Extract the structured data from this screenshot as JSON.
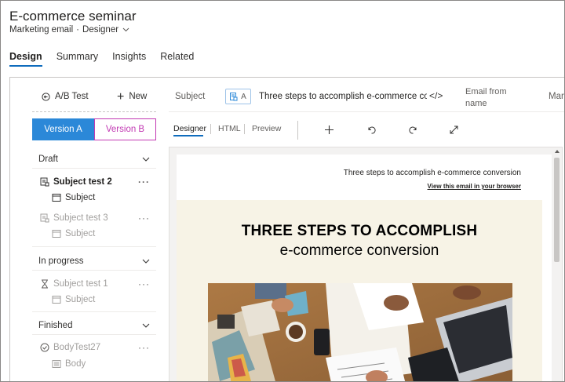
{
  "header": {
    "title": "E-commerce seminar",
    "entity": "Marketing email",
    "separator": "·",
    "form": "Designer"
  },
  "tabs": [
    {
      "label": "Design",
      "active": true
    },
    {
      "label": "Summary",
      "active": false
    },
    {
      "label": "Insights",
      "active": false
    },
    {
      "label": "Related",
      "active": false
    }
  ],
  "left_panel": {
    "ab_test_label": "A/B Test",
    "new_label": "New",
    "version_a": "Version A",
    "version_b": "Version B",
    "groups": [
      {
        "label": "Draft",
        "items": [
          {
            "name": "Subject test 2",
            "sub": "Subject",
            "style": "bold"
          },
          {
            "name": "Subject test 3",
            "sub": "Subject",
            "style": "dim"
          }
        ]
      },
      {
        "label": "In progress",
        "items": [
          {
            "name": "Subject test 1",
            "sub": "Subject",
            "style": "dim"
          }
        ]
      },
      {
        "label": "Finished",
        "items": [
          {
            "name": "BodyTest27",
            "sub": "Body",
            "style": "dim"
          }
        ]
      }
    ],
    "more_glyph": "···"
  },
  "editor": {
    "subject_label": "Subject",
    "chip_letter": "A",
    "subject_value": "Three steps to accomplish e-commerce conversion",
    "code_glyph": "</>",
    "email_from_label": "Email from name",
    "truncated_label": "Marketing",
    "toolbar": {
      "designer": "Designer",
      "html": "HTML",
      "preview": "Preview"
    }
  },
  "email": {
    "preheader": "Three steps to accomplish e-commerce conversion",
    "view_link": "View this email in your browser",
    "headline": "THREE STEPS TO ACCOMPLISH",
    "subheadline": "e-commerce conversion"
  },
  "colors": {
    "accent": "#0f6cbd",
    "version_a_bg": "#2b88d8",
    "version_b": "#c239b3",
    "hero_bg": "#f7f3e6"
  },
  "icons": [
    "ab-test-icon",
    "plus-icon",
    "chevron-down-icon",
    "subject-variant-icon",
    "subject-icon",
    "hourglass-icon",
    "check-circle-icon",
    "body-icon",
    "code-icon",
    "undo-icon",
    "redo-icon",
    "expand-icon"
  ]
}
